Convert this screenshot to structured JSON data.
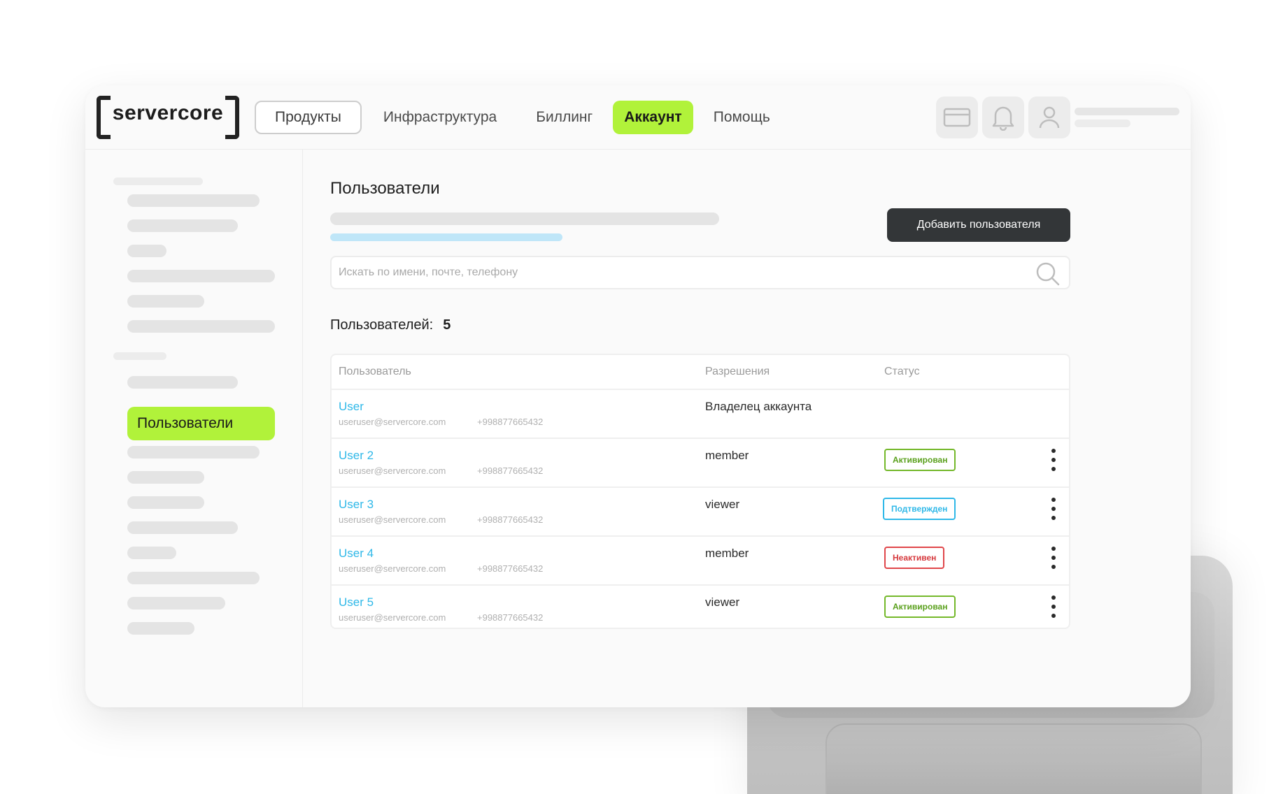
{
  "app": {
    "logo_text": "servercore"
  },
  "nav": {
    "items": [
      {
        "label": "Продукты",
        "style": "outlined"
      },
      {
        "label": "Инфраструктура",
        "style": "plain"
      },
      {
        "label": "Биллинг",
        "style": "plain"
      },
      {
        "label": "Аккаунт",
        "style": "active"
      },
      {
        "label": "Помощь",
        "style": "plain"
      }
    ],
    "icons": [
      "card-icon",
      "bell-icon",
      "user-icon"
    ]
  },
  "sidebar": {
    "active_item": "Пользователи"
  },
  "page": {
    "title": "Пользователи",
    "add_button": "Добавить пользователя",
    "search_placeholder": "Искать по имени, почте, телефону",
    "count_label": "Пользователей:",
    "count_value": "5"
  },
  "table": {
    "headers": [
      "Пользователь",
      "Разрешения",
      "Статус"
    ],
    "rows": [
      {
        "name": "User",
        "email": "useruser@servercore.com",
        "phone": "+998877665432",
        "role": "Владелец аккаунта",
        "status": ""
      },
      {
        "name": "User 2",
        "email": "useruser@servercore.com",
        "phone": "+998877665432",
        "role": "member",
        "status": "Активирован"
      },
      {
        "name": "User 3",
        "email": "useruser@servercore.com",
        "phone": "+998877665432",
        "role": "viewer",
        "status": "Подтвержден"
      },
      {
        "name": "User 4",
        "email": "useruser@servercore.com",
        "phone": "+998877665432",
        "role": "member",
        "status": "Неактивен"
      },
      {
        "name": "User 5",
        "email": "useruser@servercore.com",
        "phone": "+998877665432",
        "role": "viewer",
        "status": "Активирован"
      }
    ]
  },
  "colors": {
    "accent": "#b1f23a",
    "link": "#2fb8e8",
    "status_active": "#5aa01c",
    "status_confirmed": "#2fb8e8",
    "status_inactive": "#d63a3e",
    "dark_button": "#333638"
  }
}
